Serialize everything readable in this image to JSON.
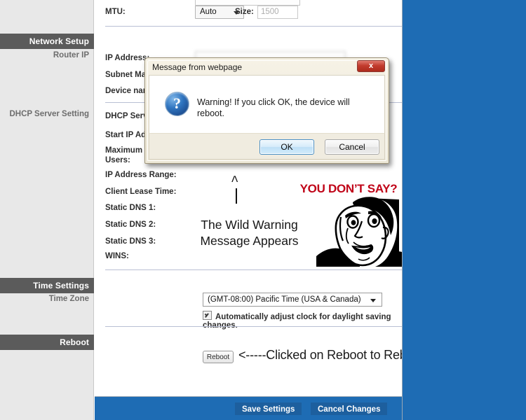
{
  "colors": {
    "desktop_blue": "#1e6cb4",
    "sidebar_header_bg": "#5b5b5b",
    "sidebar_bg": "#e8e8e8",
    "footer_bg": "#1e6cb4",
    "meme_red": "#c00418"
  },
  "sidebar": {
    "headers": [
      {
        "label": "Network Setup"
      },
      {
        "label": "Time Settings"
      },
      {
        "label": "Reboot"
      }
    ],
    "sub_labels": [
      {
        "label": "Router IP"
      },
      {
        "label": "DHCP Server Setting"
      },
      {
        "label": "Time Zone"
      }
    ]
  },
  "form": {
    "mtu": {
      "label": "MTU:",
      "select_value": "Auto",
      "size_label": "Size:",
      "size_value": "1500"
    },
    "router_ip_labels": [
      "IP Address:",
      "Subnet Mask:",
      "Device name:"
    ],
    "dhcp_labels": [
      "DHCP Server:",
      "Start IP Address:",
      "Maximum Number of",
      "Users:",
      "IP Address Range:",
      "Client Lease Time:",
      "Static DNS 1:",
      "Static DNS 2:",
      "Static DNS 3:",
      "WINS:"
    ]
  },
  "time_settings": {
    "timezone_value": "(GMT-08:00) Pacific Time (USA & Canada)",
    "dst_checkbox_label": "Automatically adjust clock for daylight saving changes.",
    "dst_checked": "true"
  },
  "reboot": {
    "button_label": "Reboot",
    "annotation": "<-----Clicked on Reboot to Reboot"
  },
  "footer": {
    "save_label": "Save Settings",
    "cancel_label": "Cancel Changes"
  },
  "dialog": {
    "title": "Message from webpage",
    "close_label": "x",
    "icon_glyph": "?",
    "message": "Warning! If you click OK, the device will reboot.",
    "ok_label": "OK",
    "cancel_label": "Cancel"
  },
  "meme": {
    "caret": "^",
    "caption_line1": "The Wild Warning",
    "caption_line2": "Message Appears",
    "headline": "YOU DON’T SAY?"
  }
}
